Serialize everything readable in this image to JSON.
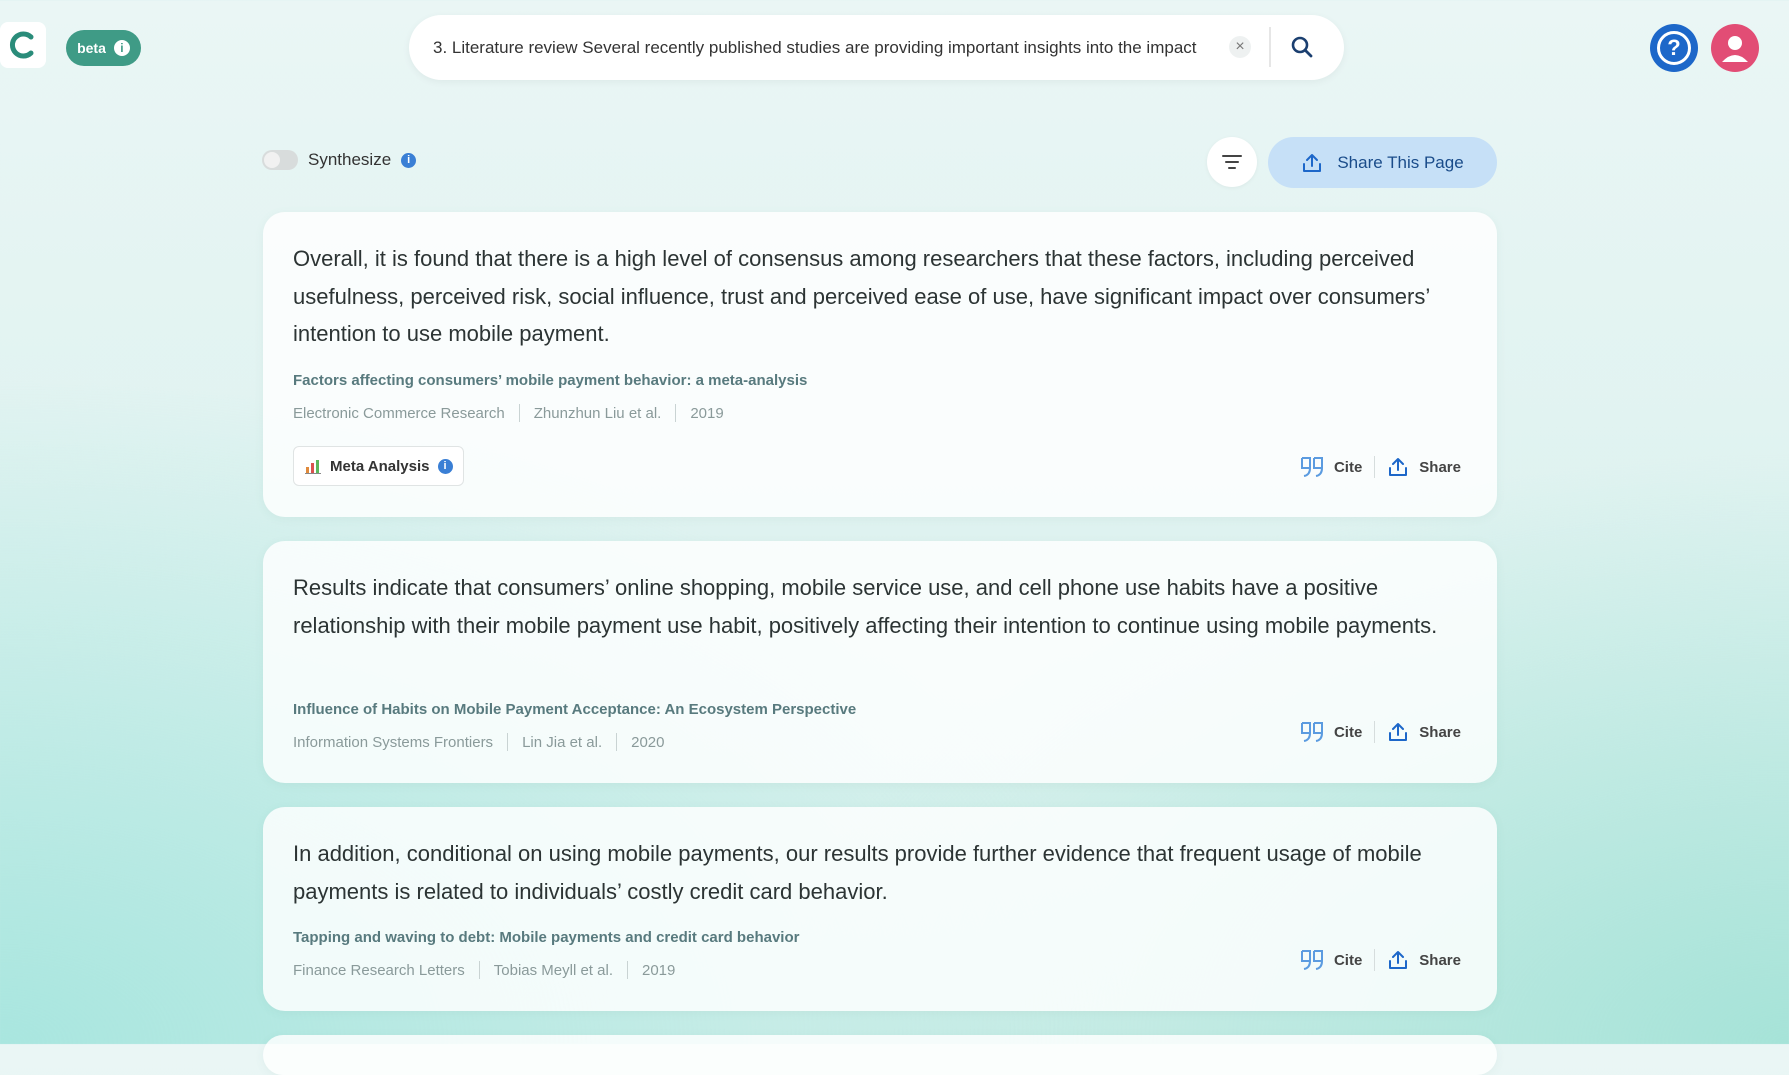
{
  "header": {
    "beta_label": "beta",
    "search_value": "3. Literature review Several recently published studies are providing important insights into the impact",
    "clear_glyph": "×",
    "help_glyph": "?"
  },
  "toolbar": {
    "synthesize_label": "Synthesize",
    "share_page_label": "Share This Page"
  },
  "results": [
    {
      "text": "Overall, it is found that there is a high level of consensus among researchers that these factors, including perceived usefulness, perceived risk, social influence, trust and perceived ease of use, have significant impact over consumers’ intention to use mobile payment.",
      "title": "Factors affecting consumers’ mobile payment behavior: a meta-analysis",
      "journal": "Electronic Commerce Research",
      "authors": "Zhunzhun Liu et al.",
      "year": "2019",
      "badge": "Meta Analysis",
      "cite": "Cite",
      "share": "Share"
    },
    {
      "text": "Results indicate that consumers’ online shopping, mobile service use, and cell phone use habits have a positive relationship with their mobile payment use habit, positively affecting their intention to continue using mobile payments.",
      "title": "Influence of Habits on Mobile Payment Acceptance: An Ecosystem Perspective",
      "journal": "Information Systems Frontiers",
      "authors": "Lin Jia et al.",
      "year": "2020",
      "cite": "Cite",
      "share": "Share"
    },
    {
      "text": "In addition, conditional on using mobile payments, our results provide further evidence that frequent usage of mobile payments is related to individuals’ costly credit card behavior.",
      "title": "Tapping and waving to debt: Mobile payments and credit card behavior",
      "journal": "Finance Research Letters",
      "authors": "Tobias Meyll et al.",
      "year": "2019",
      "cite": "Cite",
      "share": "Share"
    }
  ],
  "colors": {
    "accent": "#3f9b86",
    "help": "#1d67c9",
    "avatar": "#e24d75",
    "share_button_bg": "#c6e0f7"
  }
}
